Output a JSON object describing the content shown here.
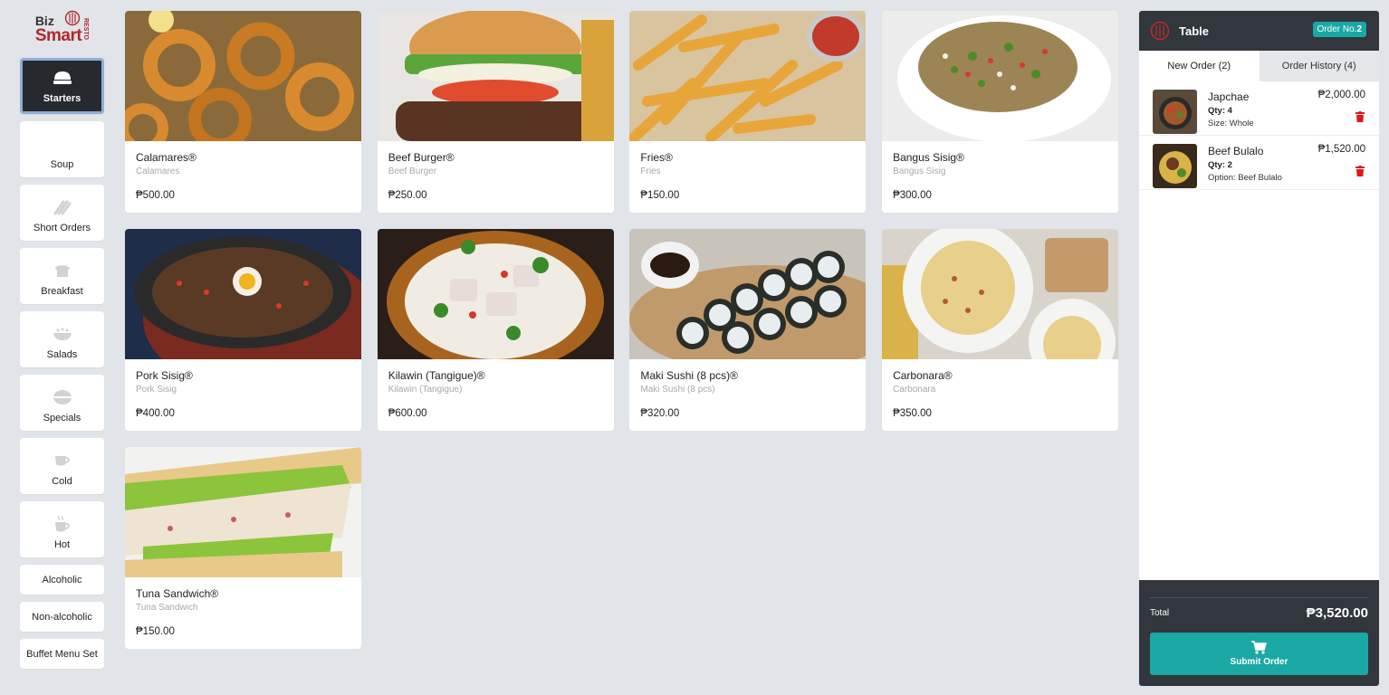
{
  "brand": {
    "line1": "Biz",
    "line2": "Smart",
    "line3": "RESTO"
  },
  "categories": [
    {
      "label": "Starters",
      "icon": "starters-icon",
      "active": true
    },
    {
      "label": "Soup",
      "icon": "soup-icon"
    },
    {
      "label": "Short Orders",
      "icon": "short-orders-icon"
    },
    {
      "label": "Breakfast",
      "icon": "breakfast-icon"
    },
    {
      "label": "Salads",
      "icon": "salads-icon"
    },
    {
      "label": "Specials",
      "icon": "specials-icon"
    },
    {
      "label": "Cold",
      "icon": "cold-drink-icon"
    },
    {
      "label": "Hot",
      "icon": "hot-drink-icon"
    },
    {
      "label": "Alcoholic"
    },
    {
      "label": "Non-alcoholic"
    },
    {
      "label": "Buffet Menu Set"
    }
  ],
  "menu": [
    {
      "name": "Calamares®",
      "sub": "Calamares",
      "price": "₱500.00"
    },
    {
      "name": "Beef Burger®",
      "sub": "Beef Burger",
      "price": "₱250.00"
    },
    {
      "name": "Fries®",
      "sub": "Fries",
      "price": "₱150.00"
    },
    {
      "name": "Bangus Sisig®",
      "sub": "Bangus Sisig",
      "price": "₱300.00"
    },
    {
      "name": "Pork Sisig®",
      "sub": "Pork Sisig",
      "price": "₱400.00"
    },
    {
      "name": "Kilawin (Tangigue)®",
      "sub": "Kilawin (Tangigue)",
      "price": "₱600.00"
    },
    {
      "name": "Maki Sushi (8 pcs)®",
      "sub": "Maki Sushi (8 pcs)",
      "price": "₱320.00"
    },
    {
      "name": "Carbonara®",
      "sub": "Carbonara",
      "price": "₱350.00"
    },
    {
      "name": "Tuna Sandwich®",
      "sub": "Tuna Sandwich",
      "price": "₱150.00"
    }
  ],
  "order": {
    "title": "Table",
    "badge_label": "Order No.",
    "badge_number": "2",
    "tabs": [
      {
        "label": "New Order (2)"
      },
      {
        "label": "Order History (4)"
      }
    ],
    "items": [
      {
        "name": "Japchae",
        "qty": "Qty: 4",
        "option": "Size: Whole",
        "price": "₱2,000.00"
      },
      {
        "name": "Beef Bulalo",
        "qty": "Qty: 2",
        "option": "Option: Beef Bulalo",
        "price": "₱1,520.00"
      }
    ],
    "total_label": "Total",
    "total_value": "₱3,520.00",
    "submit_label": "Submit Order"
  },
  "colors": {
    "accent": "#1aa8a5",
    "dark": "#32373d",
    "brand_red": "#b0282c",
    "delete_red": "#e0161c"
  }
}
